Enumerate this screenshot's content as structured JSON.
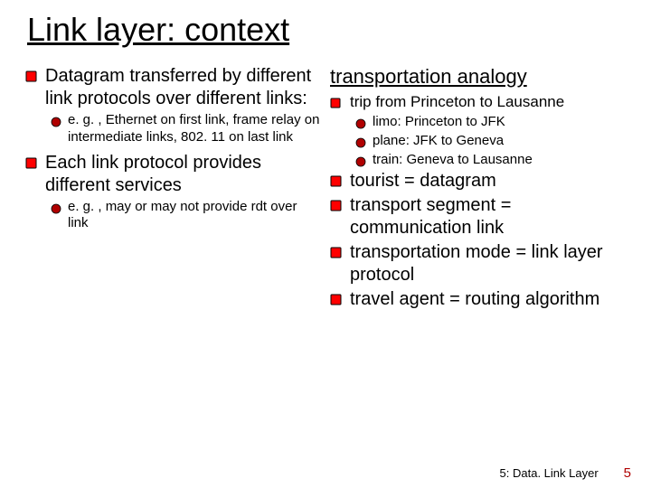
{
  "title": "Link layer: context",
  "left": {
    "items": [
      {
        "text": "Datagram transferred by different link protocols over different links:",
        "sub": [
          "e. g. , Ethernet on first link, frame relay on intermediate links, 802. 11 on last link"
        ]
      },
      {
        "text": "Each  link protocol provides different services",
        "sub": [
          "e. g. , may or may not provide rdt over link"
        ]
      }
    ]
  },
  "right": {
    "heading": "transportation analogy",
    "items": [
      {
        "text": "trip from Princeton to Lausanne",
        "small": true,
        "sub": [
          "limo: Princeton to JFK",
          "plane: JFK to Geneva",
          "train: Geneva to Lausanne"
        ]
      },
      {
        "text": "tourist = datagram",
        "sub": []
      },
      {
        "text": "transport segment = communication link",
        "sub": []
      },
      {
        "text": "transportation mode = link layer protocol",
        "sub": []
      },
      {
        "text": "travel agent = routing algorithm",
        "sub": []
      }
    ]
  },
  "footer": {
    "chapter": "5: Data. Link Layer",
    "page": "5"
  }
}
